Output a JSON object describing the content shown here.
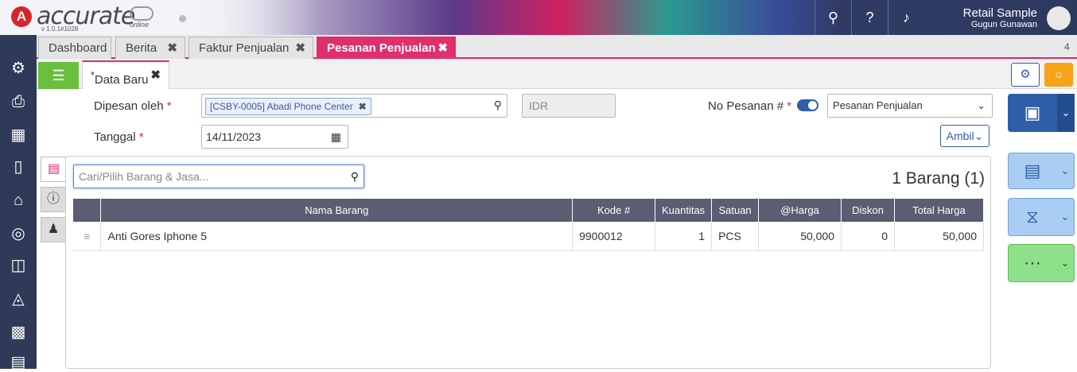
{
  "app": {
    "brand": "accurate",
    "version": "v 1.0.1#1028",
    "online": "online",
    "user_name": "Retail Sample",
    "user_company": "Gugun Gunawan"
  },
  "tabs": [
    {
      "label": "Dashboard"
    },
    {
      "label": "Berita"
    },
    {
      "label": "Faktur Penjualan"
    },
    {
      "label": "Pesanan Penjualan"
    }
  ],
  "tab_count": "4",
  "subtab": {
    "label": "Data Baru"
  },
  "form": {
    "dipesan_label": "Dipesan oleh",
    "customer": "[CSBY-0005] Abadi Phone Center",
    "currency": "IDR",
    "no_pesanan_label": "No Pesanan #",
    "type_select": "Pesanan Penjualan",
    "tanggal_label": "Tanggal",
    "tanggal": "14/11/2023",
    "ambil": "Ambil"
  },
  "items": {
    "search_placeholder": "Cari/Pilih Barang & Jasa...",
    "count": "1 Barang (1)",
    "columns": [
      "Nama Barang",
      "Kode #",
      "Kuantitas",
      "Satuan",
      "@Harga",
      "Diskon",
      "Total Harga"
    ],
    "rows": [
      {
        "nama": "Anti Gores Iphone 5",
        "kode": "9900012",
        "qty": "1",
        "satuan": "PCS",
        "harga": "50,000",
        "diskon": "0",
        "total": "50,000"
      }
    ]
  },
  "colors": {
    "accent": "#e12e6c",
    "primary": "#2e5ea8",
    "sidebar": "#2e3a57",
    "success": "#6abf3f"
  }
}
